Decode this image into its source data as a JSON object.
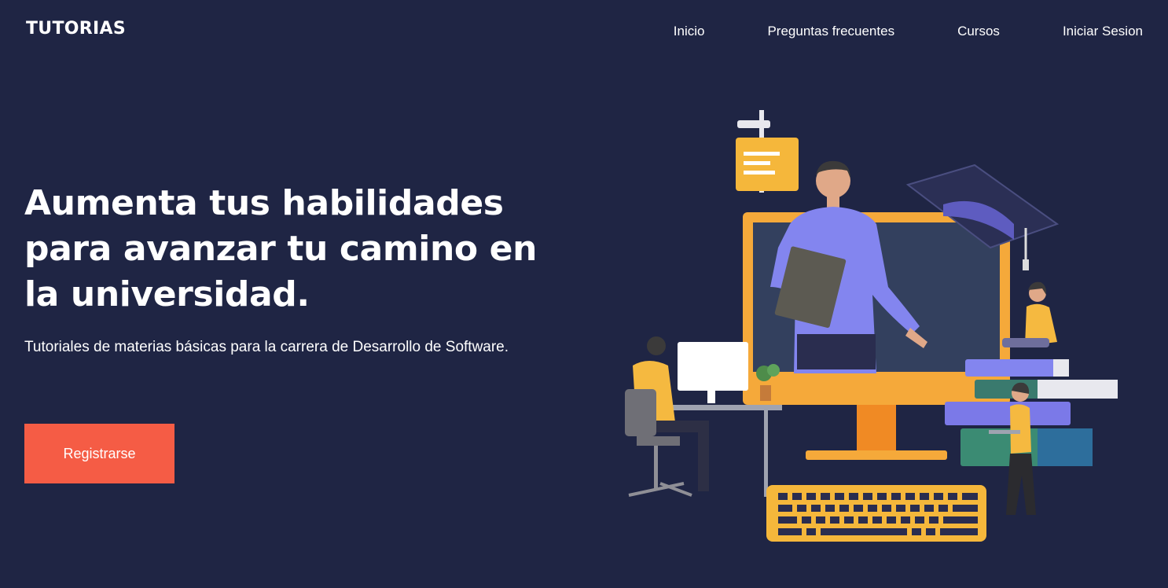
{
  "header": {
    "logo": "TUTORIAS",
    "nav": [
      {
        "label": "Inicio"
      },
      {
        "label": "Preguntas frecuentes"
      },
      {
        "label": "Cursos"
      },
      {
        "label": "Iniciar Sesion"
      }
    ]
  },
  "hero": {
    "title": "Aumenta tus habilidades para avanzar tu camino en la universidad.",
    "subtitle": "Tutoriales de materias básicas para la carrera de Desarrollo de Software.",
    "cta_label": "Registrarse"
  },
  "colors": {
    "background": "#1f2544",
    "accent": "#f55c45",
    "illustration_orange": "#f5a623",
    "illustration_purple": "#7b79e8"
  },
  "icons": [
    "online-education-illustration"
  ]
}
